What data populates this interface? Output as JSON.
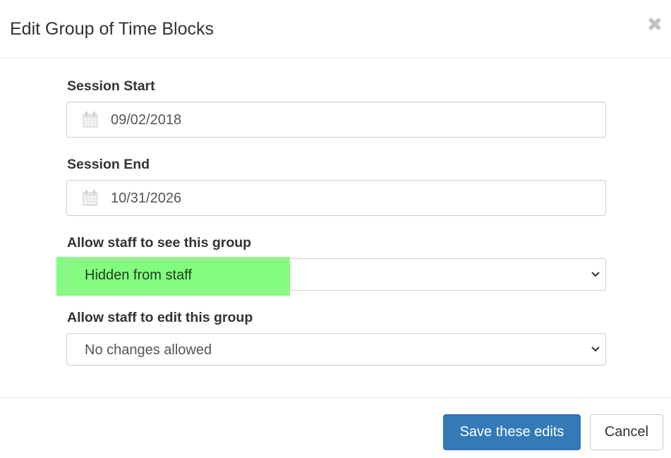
{
  "dialog": {
    "title": "Edit Group of Time Blocks",
    "close_icon": "close-icon"
  },
  "form": {
    "session_start": {
      "label": "Session Start",
      "value": "09/02/2018",
      "icon": "calendar-icon"
    },
    "session_end": {
      "label": "Session End",
      "value": "10/31/2026",
      "icon": "calendar-icon"
    },
    "staff_visibility": {
      "label": "Allow staff to see this group",
      "selected": "Hidden from staff",
      "highlight_color": "#7cfc78"
    },
    "staff_edit": {
      "label": "Allow staff to edit this group",
      "selected": "No changes allowed"
    }
  },
  "footer": {
    "save_label": "Save these edits",
    "cancel_label": "Cancel"
  },
  "colors": {
    "primary": "#337ab7",
    "border": "#cccccc",
    "text": "#333333",
    "muted_text": "#555555"
  }
}
